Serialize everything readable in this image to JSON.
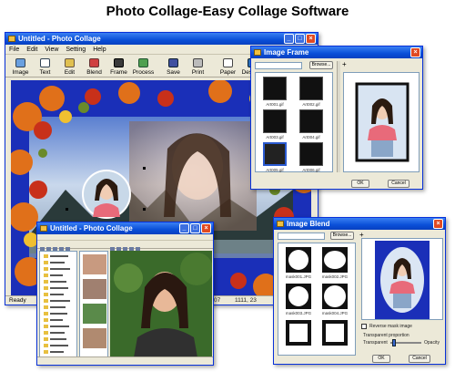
{
  "headline": "Photo Collage-Easy Collage Software",
  "colors": {
    "titlebar": "#0a4fd8",
    "canvas_bg": "#1a2fb8",
    "close_button": "#e04a22",
    "chrome": "#ece9d8"
  },
  "main_window": {
    "title": "Untitled - Photo Collage",
    "menu": [
      "File",
      "Edit",
      "View",
      "Setting",
      "Help"
    ],
    "toolbar": [
      {
        "label": "Image",
        "icon": "image-icon"
      },
      {
        "label": "Text",
        "icon": "text-icon"
      },
      {
        "label": "Edit",
        "icon": "edit-icon"
      },
      {
        "label": "Blend",
        "icon": "blend-icon"
      },
      {
        "label": "Frame",
        "icon": "frame-icon"
      },
      {
        "label": "Process",
        "icon": "process-icon"
      },
      {
        "label": "Save",
        "icon": "save-icon"
      },
      {
        "label": "Print",
        "icon": "print-icon"
      },
      {
        "label": "Paper",
        "icon": "paper-icon"
      },
      {
        "label": "Desktop",
        "icon": "desktop-icon"
      }
    ],
    "status": "Ready"
  },
  "frame_window": {
    "title": "Image Frame",
    "browse_label": "Browse...",
    "thumbs": [
      "Art001.gif",
      "Art002.gif",
      "Art003.gif",
      "Art004.gif",
      "Art005.gif",
      "Art006.gif"
    ],
    "ok_label": "OK",
    "cancel_label": "Cancel"
  },
  "explorer_window": {
    "title": "Untitled - Photo Collage",
    "status_coords": "1111, 23",
    "status_num": "07"
  },
  "blend_window": {
    "title": "Image Blend",
    "browse_label": "Browse...",
    "masks": [
      "mask001.JPG",
      "mask002.JPG",
      "mask003.JPG",
      "mask004.JPG"
    ],
    "checkbox_label": "Reverse mask image",
    "transparency_label": "Transparent proportion",
    "transparent_label": "Transparent",
    "opacity_label": "Opacity",
    "ok_label": "OK",
    "cancel_label": "Cancel"
  }
}
